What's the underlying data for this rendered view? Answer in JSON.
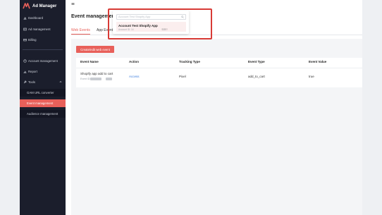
{
  "app": {
    "title": "Ad Manager"
  },
  "sidebar": {
    "items": [
      {
        "label": "Dashboard",
        "icon": "bar-chart-icon"
      },
      {
        "label": "Ad management",
        "icon": "ad-icon"
      },
      {
        "label": "Billing",
        "icon": "billing-icon"
      },
      {
        "label": "Account management",
        "icon": "account-icon"
      },
      {
        "label": "Report",
        "icon": "report-icon"
      },
      {
        "label": "Tools",
        "icon": "wrench-icon",
        "expanded": true
      }
    ],
    "subitems": [
      {
        "label": "GAM URL converter",
        "active": false
      },
      {
        "label": "Event management",
        "active": true
      },
      {
        "label": "Audience management",
        "active": false
      }
    ]
  },
  "page": {
    "title": "Event management"
  },
  "tabs": [
    {
      "label": "Web Events",
      "active": true
    },
    {
      "label": "App Events",
      "active": false
    }
  ],
  "actions": {
    "create_label": "Create/edit web event"
  },
  "table": {
    "headers": [
      "Event Name",
      "Action",
      "Tracking Type",
      "Event Type",
      "Event Value"
    ],
    "rows": [
      {
        "name": "Shopify app add to cart",
        "id_prefix": "Event ID:",
        "action": "Access",
        "tracking_type": "Pixel",
        "event_type": "add_to_cart",
        "event_value": "true"
      }
    ]
  },
  "dropdown": {
    "placeholder": "Account Test Shopify App",
    "option_title": "Account Test Shopify App",
    "option_sub": "Account ID: 14",
    "option_tail": "1.0"
  },
  "colors": {
    "accent": "#e8605a",
    "sidebar": "#1b1e2c",
    "link": "#3b7ddd",
    "highlight": "#d83b36"
  }
}
